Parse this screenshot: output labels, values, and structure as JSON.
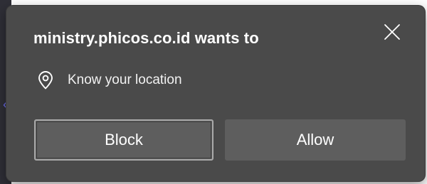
{
  "dialog": {
    "title": "ministry.phicos.co.id wants to",
    "permission": {
      "icon": "location-pin-icon",
      "label": "Know your location"
    },
    "close_icon": "close-icon",
    "buttons": {
      "block_label": "Block",
      "allow_label": "Allow"
    }
  },
  "colors": {
    "dialog_background": "#4a4a4a",
    "button_background": "#5e5e5e",
    "focus_ring": "#a8a8a8",
    "text": "#ffffff",
    "page_edge": "#2f2f37",
    "page_edge_chevron": "#6d6df0"
  }
}
